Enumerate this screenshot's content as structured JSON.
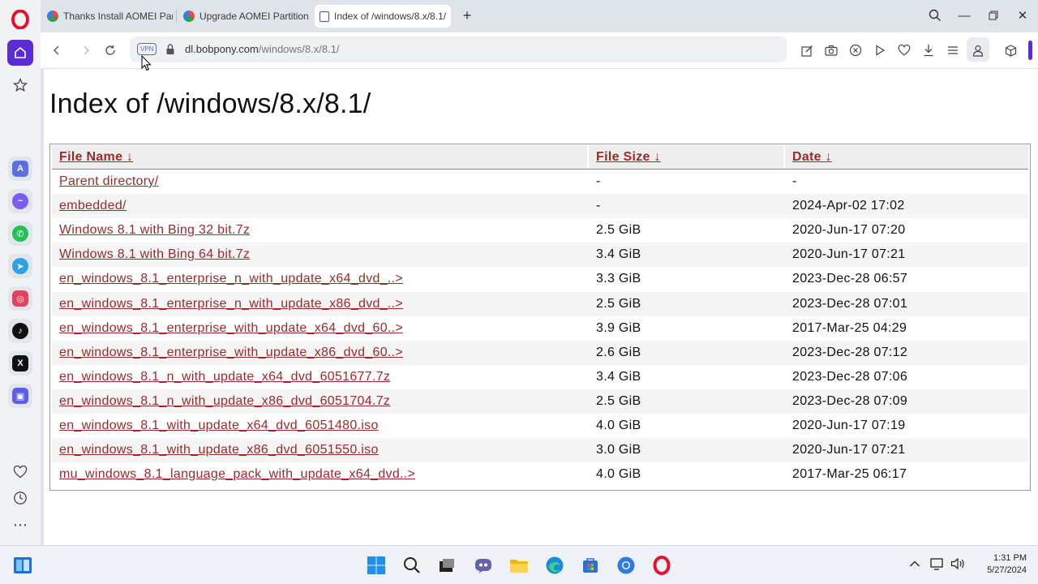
{
  "tabs": [
    {
      "title": "Thanks Install AOMEI Partition",
      "active": false
    },
    {
      "title": "Upgrade AOMEI Partition Assistant",
      "active": false
    },
    {
      "title": "Index of /windows/8.x/8.1/",
      "active": true
    }
  ],
  "toolbar": {
    "vpn_label": "VPN",
    "url_host": "dl.bobpony.com",
    "url_path": "/windows/8.x/8.1/"
  },
  "page": {
    "title": "Index of /windows/8.x/8.1/",
    "columns": [
      "File Name  ↓",
      "File Size  ↓",
      "Date  ↓"
    ],
    "rows": [
      {
        "name": "Parent directory/",
        "size": "-",
        "date": "-"
      },
      {
        "name": "embedded/",
        "size": "-",
        "date": "2024-Apr-02 17:02"
      },
      {
        "name": "Windows 8.1 with Bing 32 bit.7z",
        "size": "2.5 GiB",
        "date": "2020-Jun-17 07:20"
      },
      {
        "name": "Windows 8.1 with Bing 64 bit.7z",
        "size": "3.4 GiB",
        "date": "2020-Jun-17 07:21"
      },
      {
        "name": "en_windows_8.1_enterprise_n_with_update_x64_dvd_..>",
        "size": "3.3 GiB",
        "date": "2023-Dec-28 06:57"
      },
      {
        "name": "en_windows_8.1_enterprise_n_with_update_x86_dvd_..>",
        "size": "2.5 GiB",
        "date": "2023-Dec-28 07:01"
      },
      {
        "name": "en_windows_8.1_enterprise_with_update_x64_dvd_60..>",
        "size": "3.9 GiB",
        "date": "2017-Mar-25 04:29"
      },
      {
        "name": "en_windows_8.1_enterprise_with_update_x86_dvd_60..>",
        "size": "2.6 GiB",
        "date": "2023-Dec-28 07:12"
      },
      {
        "name": "en_windows_8.1_n_with_update_x64_dvd_6051677.7z",
        "size": "3.4 GiB",
        "date": "2023-Dec-28 07:06"
      },
      {
        "name": "en_windows_8.1_n_with_update_x86_dvd_6051704.7z",
        "size": "2.5 GiB",
        "date": "2023-Dec-28 07:09"
      },
      {
        "name": "en_windows_8.1_with_update_x64_dvd_6051480.iso",
        "size": "4.0 GiB",
        "date": "2020-Jun-17 07:19"
      },
      {
        "name": "en_windows_8.1_with_update_x86_dvd_6051550.iso",
        "size": "3.0 GiB",
        "date": "2020-Jun-17 07:21"
      },
      {
        "name": "mu_windows_8.1_language_pack_with_update_x64_dvd..>",
        "size": "4.0 GiB",
        "date": "2017-Mar-25 06:17"
      }
    ]
  },
  "taskbar": {
    "time": "1:31 PM",
    "date": "5/27/2024"
  },
  "colors": {
    "opera_red": "#e0142c",
    "sidebar_accent": "#5b2bd6",
    "link": "#9a2a2a"
  },
  "icons": [
    "opera-logo",
    "home-icon",
    "star-icon",
    "aria-icon",
    "messenger-icon",
    "whatsapp-icon",
    "telegram-icon",
    "instagram-icon",
    "tiktok-icon",
    "x-icon",
    "player-icon",
    "heart-icon",
    "history-icon",
    "more-icon"
  ]
}
